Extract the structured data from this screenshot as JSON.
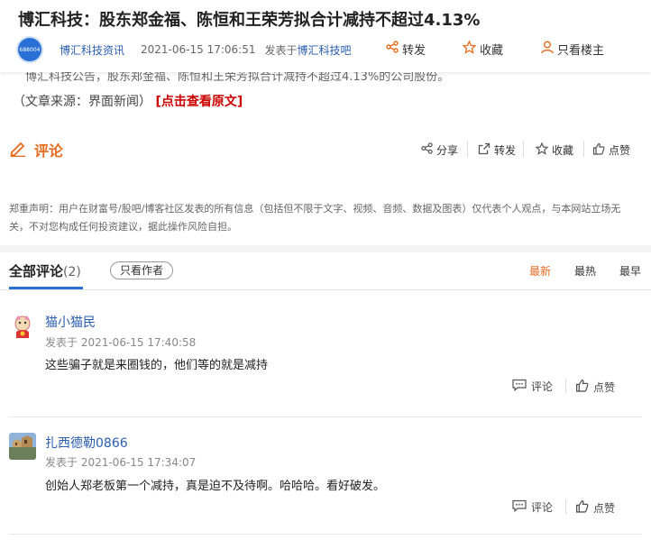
{
  "header": {
    "title": "博汇科技：股东郑金福、陈恒和王荣芳拟合计减持不超过4.13%",
    "badge_text": "688004",
    "author": "博汇科技资讯",
    "time": "2021-06-15 17:06:51",
    "posted_in_prefix": "发表于",
    "posted_in_bar": "博汇科技吧",
    "actions": {
      "share": "转发",
      "favorite": "收藏",
      "only_op": "只看楼主"
    }
  },
  "article": {
    "ghost_text": "博汇科技公告，股东郑金福、陈恒和王荣芳拟合计减持不超过4.13%的公司股份。",
    "source_text": "（文章来源：界面新闻）",
    "source_link": "[点击查看原文]"
  },
  "comment_section": {
    "label": "评论",
    "actions": {
      "share": "分享",
      "forward": "转发",
      "favorite": "收藏",
      "like": "点赞"
    }
  },
  "disclaimer": "郑重声明：用户在财富号/股吧/博客社区发表的所有信息（包括但不限于文字、视频、音频、数据及图表）仅代表个人观点，与本网站立场无关，不对您构成任何投资建议，据此操作风险自担。",
  "tabs": {
    "all_label": "全部评论",
    "count": "(2)",
    "only_author": "只看作者",
    "sort": {
      "latest": "最新",
      "hottest": "最热",
      "earliest": "最早"
    }
  },
  "comments": [
    {
      "user": "猫小猫民",
      "time": "发表于 2021-06-15 17:40:58",
      "text": "这些骗子就是来圈钱的，他们等的就是减持",
      "reply": "评论",
      "like": "点赞"
    },
    {
      "user": "扎西德勒0866",
      "time": "发表于 2021-06-15 17:34:07",
      "text": "创始人郑老板第一个减持，真是迫不及待啊。哈哈哈。看好破发。",
      "reply": "评论",
      "like": "点赞"
    }
  ],
  "colors": {
    "accent": "#e86a1f",
    "link": "#2a5db0",
    "source_link": "#cc0000",
    "tab_underline": "#2a6fd6"
  },
  "icons": [
    "share-icon",
    "star-icon",
    "person-icon",
    "pencil-icon",
    "forward-icon",
    "thumbs-up-icon",
    "comment-icon"
  ]
}
